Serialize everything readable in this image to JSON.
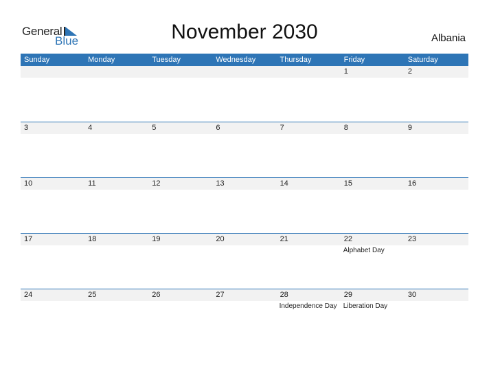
{
  "logo": {
    "word1": "General",
    "word2": "Blue"
  },
  "title": "November 2030",
  "country": "Albania",
  "colors": {
    "accent": "#2e75b6",
    "strip": "#f2f2f2"
  },
  "weekdays": [
    "Sunday",
    "Monday",
    "Tuesday",
    "Wednesday",
    "Thursday",
    "Friday",
    "Saturday"
  ],
  "weeks": [
    [
      {
        "day": ""
      },
      {
        "day": ""
      },
      {
        "day": ""
      },
      {
        "day": ""
      },
      {
        "day": ""
      },
      {
        "day": "1"
      },
      {
        "day": "2"
      }
    ],
    [
      {
        "day": "3"
      },
      {
        "day": "4"
      },
      {
        "day": "5"
      },
      {
        "day": "6"
      },
      {
        "day": "7"
      },
      {
        "day": "8"
      },
      {
        "day": "9"
      }
    ],
    [
      {
        "day": "10"
      },
      {
        "day": "11"
      },
      {
        "day": "12"
      },
      {
        "day": "13"
      },
      {
        "day": "14"
      },
      {
        "day": "15"
      },
      {
        "day": "16"
      }
    ],
    [
      {
        "day": "17"
      },
      {
        "day": "18"
      },
      {
        "day": "19"
      },
      {
        "day": "20"
      },
      {
        "day": "21"
      },
      {
        "day": "22",
        "holiday": "Alphabet Day"
      },
      {
        "day": "23"
      }
    ],
    [
      {
        "day": "24"
      },
      {
        "day": "25"
      },
      {
        "day": "26"
      },
      {
        "day": "27"
      },
      {
        "day": "28",
        "holiday": "Independence Day"
      },
      {
        "day": "29",
        "holiday": "Liberation Day"
      },
      {
        "day": "30"
      }
    ]
  ]
}
